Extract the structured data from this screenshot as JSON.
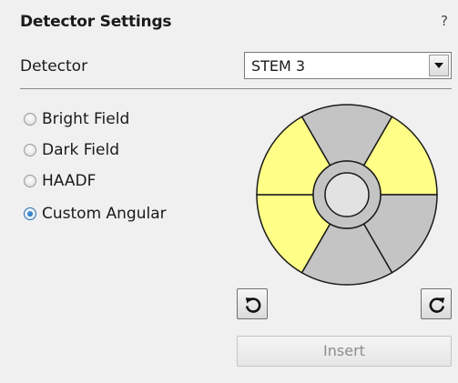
{
  "panel": {
    "title": "Detector Settings",
    "help_label": "?"
  },
  "detector": {
    "label": "Detector",
    "selected": "STEM 3"
  },
  "modes": [
    {
      "label": "Bright Field",
      "checked": false
    },
    {
      "label": "Dark Field",
      "checked": false
    },
    {
      "label": "HAADF",
      "checked": false
    },
    {
      "label": "Custom Angular",
      "checked": true
    }
  ],
  "segments": {
    "outer_ring": [
      {
        "position": "top",
        "active": false
      },
      {
        "position": "upper-right",
        "active": true
      },
      {
        "position": "lower-right",
        "active": false
      },
      {
        "position": "bottom",
        "active": false
      },
      {
        "position": "lower-left",
        "active": true
      },
      {
        "position": "upper-left",
        "active": true
      }
    ],
    "middle_ring_active": false,
    "center_active": false
  },
  "colors": {
    "active_segment": "#ffff88",
    "inactive_segment": "#c4c4c4",
    "center": "#e2e2e2",
    "panel_background": "#f0f0f0"
  },
  "buttons": {
    "rotate_left_icon": "rotate-counterclockwise-icon",
    "rotate_right_icon": "rotate-clockwise-icon",
    "insert_label": "Insert",
    "insert_enabled": false
  }
}
